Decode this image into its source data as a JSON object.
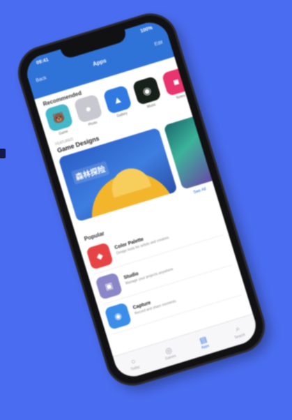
{
  "colors": {
    "background": "#4a6cf0",
    "header": "#2f72d8",
    "accent": "#2f72d8"
  },
  "status": {
    "time": "09:41",
    "battery": "100%"
  },
  "nav": {
    "back": "Back",
    "title": "Apps",
    "action": "Edit"
  },
  "sections": {
    "recommended": "Recommended",
    "featured_eyebrow": "FEATURED",
    "featured_title": "Game Designs",
    "popular": "Popular",
    "see_all": "See All"
  },
  "apps": [
    {
      "label": "Game",
      "icon": "game-icon",
      "color": "#44b7c9",
      "glyph": "🐻"
    },
    {
      "label": "Photo",
      "icon": "photo-icon",
      "color": "#c8c8d0",
      "glyph": "●"
    },
    {
      "label": "Gallery",
      "icon": "gallery-icon",
      "color": "#2f79e0",
      "glyph": "▲"
    },
    {
      "label": "Music",
      "icon": "music-icon",
      "color": "#18201a",
      "glyph": "◉"
    },
    {
      "label": "Notes",
      "icon": "notes-icon",
      "color": "#e8356f",
      "glyph": "■"
    }
  ],
  "banner": {
    "text": "森林探险"
  },
  "list": [
    {
      "name": "Color Palette",
      "desc": "Design tools for artists and creators",
      "icon": "palette-icon",
      "color": "#e64444",
      "glyph": "◆"
    },
    {
      "name": "Studio",
      "desc": "Manage your projects anywhere",
      "icon": "studio-icon",
      "color": "#8a86c8",
      "glyph": "▣"
    },
    {
      "name": "Capture",
      "desc": "Record and share moments",
      "icon": "capture-icon",
      "color": "#3a8de8",
      "glyph": "◉"
    }
  ],
  "tabs": [
    {
      "label": "Today",
      "icon": "today-icon",
      "glyph": "○"
    },
    {
      "label": "Games",
      "icon": "games-icon",
      "glyph": "◎"
    },
    {
      "label": "Apps",
      "icon": "apps-icon",
      "glyph": "▤"
    },
    {
      "label": "Search",
      "icon": "search-icon",
      "glyph": "⌕"
    }
  ]
}
